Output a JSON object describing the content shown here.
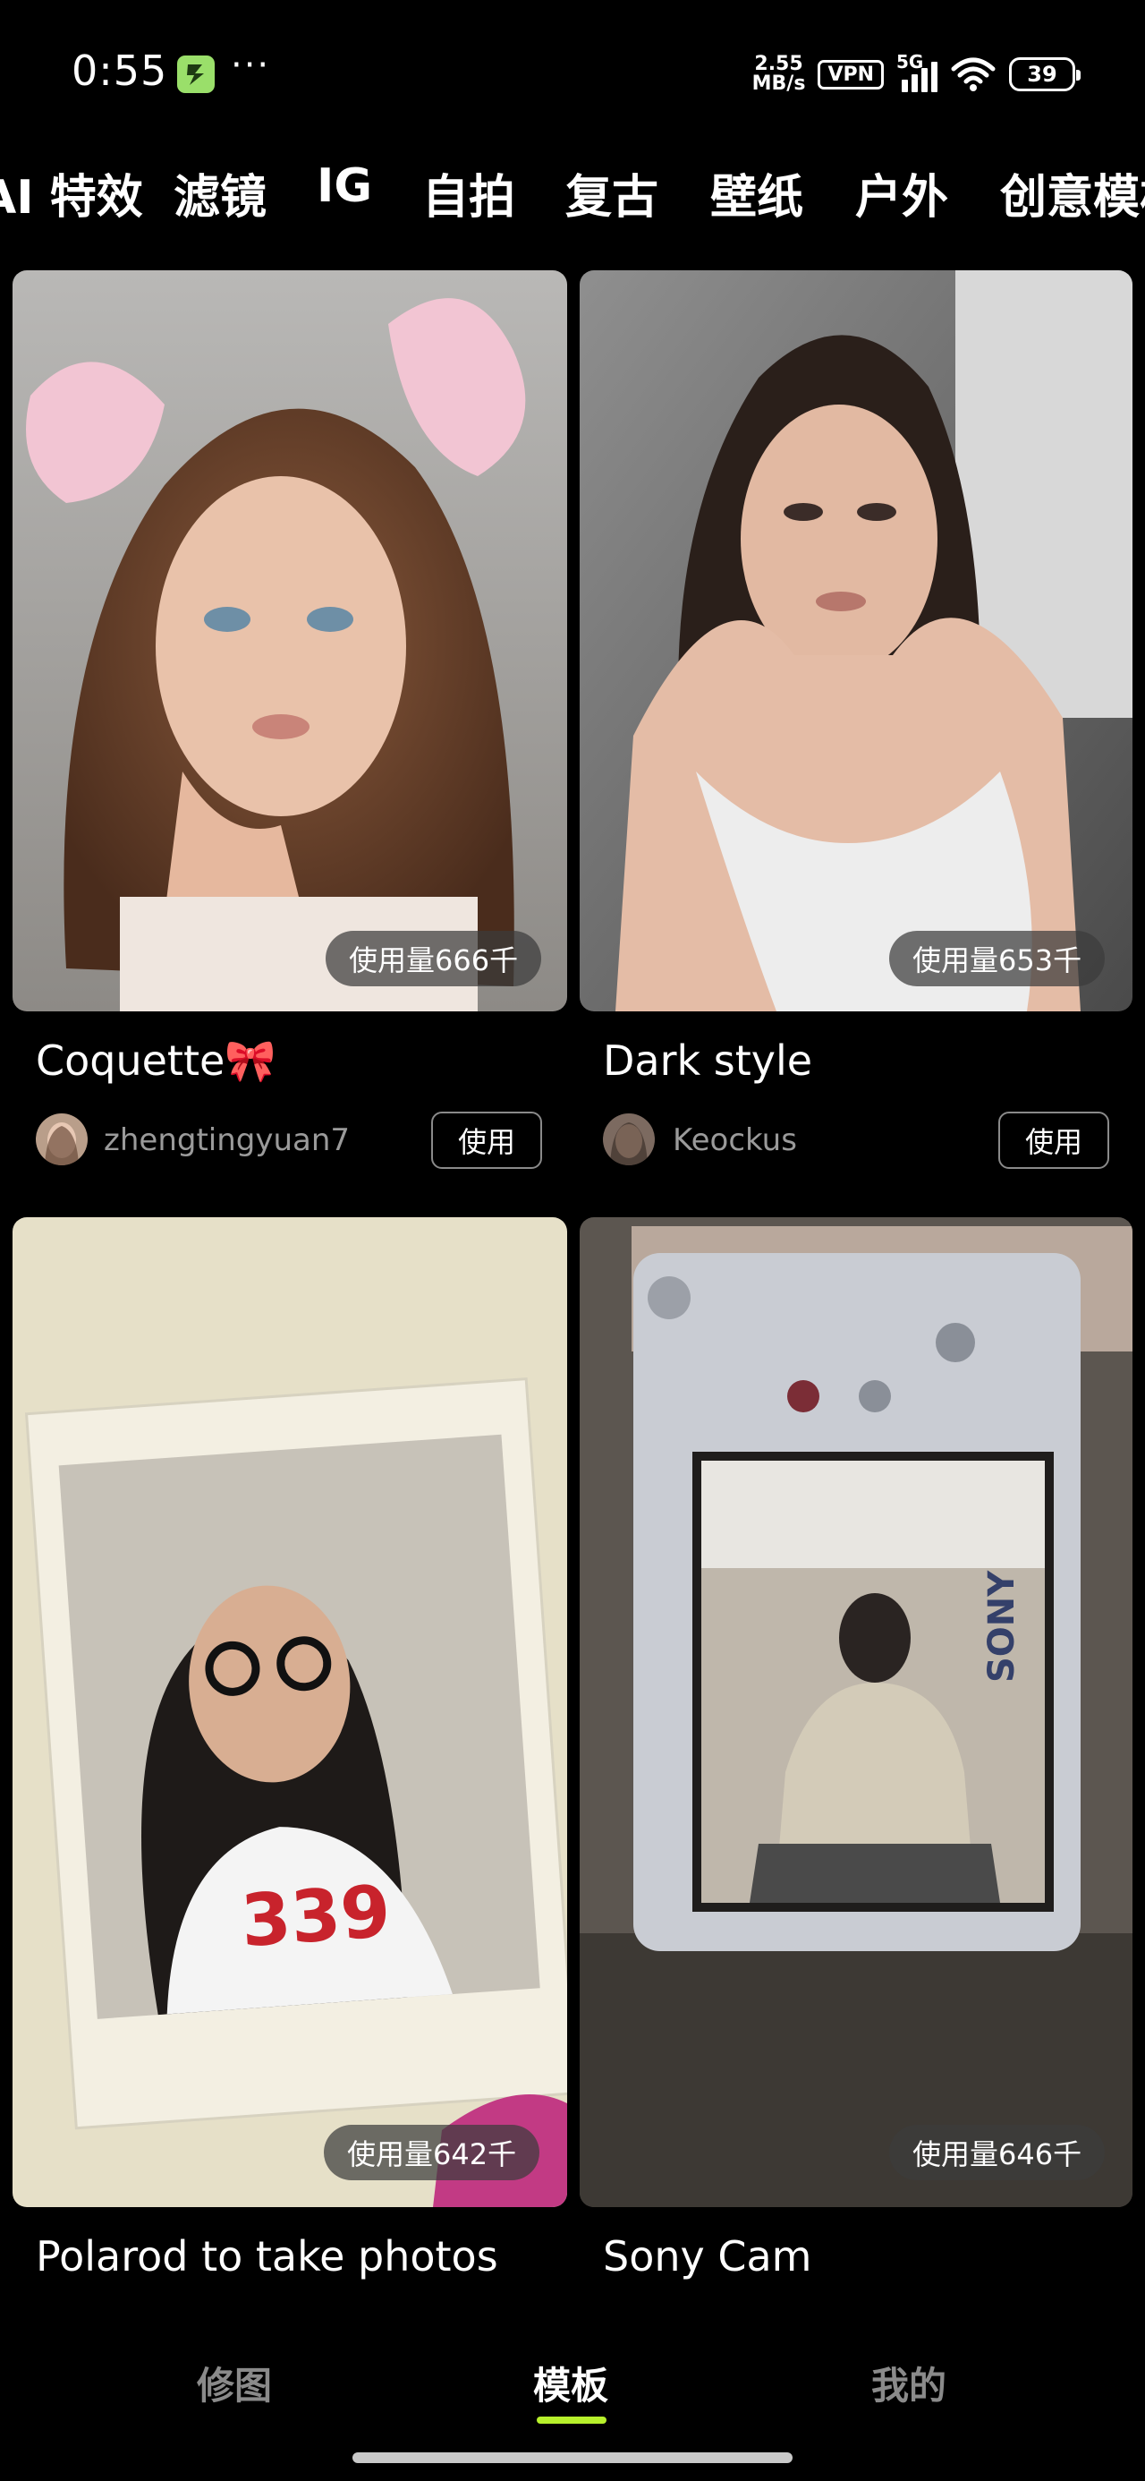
{
  "status_bar": {
    "time": "0:55",
    "app_icon": "notification-app-icon",
    "more": "···",
    "net_speed_value": "2.55",
    "net_speed_unit": "MB/s",
    "vpn": "VPN",
    "network": "5G",
    "battery": "39"
  },
  "tabs": [
    "AI 特效",
    "滤镜",
    "IG",
    "自拍",
    "复古",
    "壁纸",
    "户外",
    "创意模板"
  ],
  "cards": [
    {
      "title": "Coquette🎀",
      "author": "zhengtingyuan7",
      "usage": "使用量666千",
      "use_label": "使用"
    },
    {
      "title": "Dark style",
      "author": "Keockus",
      "usage": "使用量653千",
      "use_label": "使用"
    },
    {
      "title": "Polarod to take photos",
      "usage": "使用量642千"
    },
    {
      "title": "Sony Cam",
      "usage": "使用量646千"
    }
  ],
  "bottom_nav": {
    "items": [
      "修图",
      "模板",
      "我的"
    ],
    "active": "模板",
    "active_color": "#b7f02c"
  }
}
